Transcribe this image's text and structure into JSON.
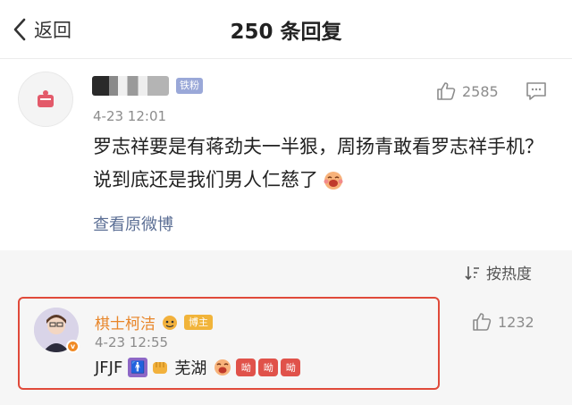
{
  "nav": {
    "back_label": "返回",
    "title": "250 条回复"
  },
  "comment": {
    "avatar_icon": "weibo-default-avatar",
    "badge": "铁粉",
    "time": "4-23 12:01",
    "likes": "2585",
    "content": "罗志祥要是有蒋劲夫一半狠，周扬青敢看罗志祥手机？说到底还是我们男人仁慈了",
    "view_original": "查看原微博"
  },
  "sort": {
    "label": "按热度"
  },
  "reply": {
    "username": "棋士柯洁",
    "badge": "博主",
    "verified_mark": "v",
    "time": "4-23 12:55",
    "text_prefix": "JFJF",
    "person_glyph": "🚹",
    "place": "芜湖",
    "stickers": [
      "呦",
      "呦",
      "呦"
    ],
    "likes": "1232"
  },
  "colors": {
    "accent_orange": "#e8862a",
    "link_blue": "#5c6f95",
    "highlight_border": "#e04a3a"
  }
}
